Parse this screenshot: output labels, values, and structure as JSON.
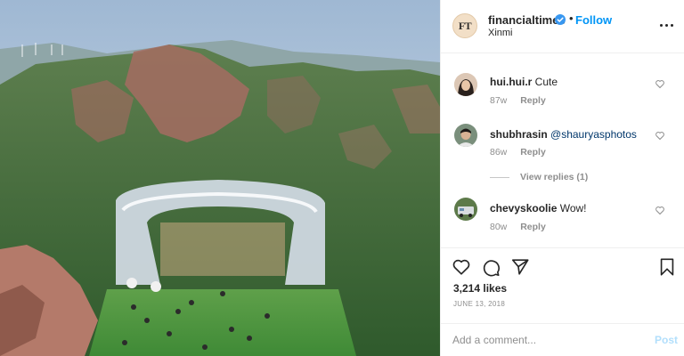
{
  "post": {
    "avatar_text": "FT",
    "username": "financialtimes",
    "separator": "•",
    "follow_label": "Follow",
    "location": "Xinmi"
  },
  "comments": [
    {
      "username": "hui.hui.r",
      "text": "Cute",
      "time": "87w",
      "reply_label": "Reply"
    },
    {
      "username": "shubhrasin",
      "text": "@shauryasphotos",
      "time": "86w",
      "reply_label": "Reply"
    },
    {
      "username": "chevyskoolie",
      "text": "Wow!",
      "time": "80w",
      "reply_label": "Reply"
    }
  ],
  "view_replies": "View replies (1)",
  "likes": "3,214 likes",
  "date": "JUNE 13, 2018",
  "comment_input": {
    "placeholder": "Add a comment...",
    "post_label": "Post"
  },
  "colors": {
    "accent": "#0095f6",
    "text": "#262626",
    "muted": "#8e8e8e",
    "post_disabled": "#b2dffc"
  },
  "icons": [
    "verified-icon",
    "more-icon",
    "heart-icon",
    "comment-icon",
    "share-icon",
    "bookmark-icon"
  ]
}
